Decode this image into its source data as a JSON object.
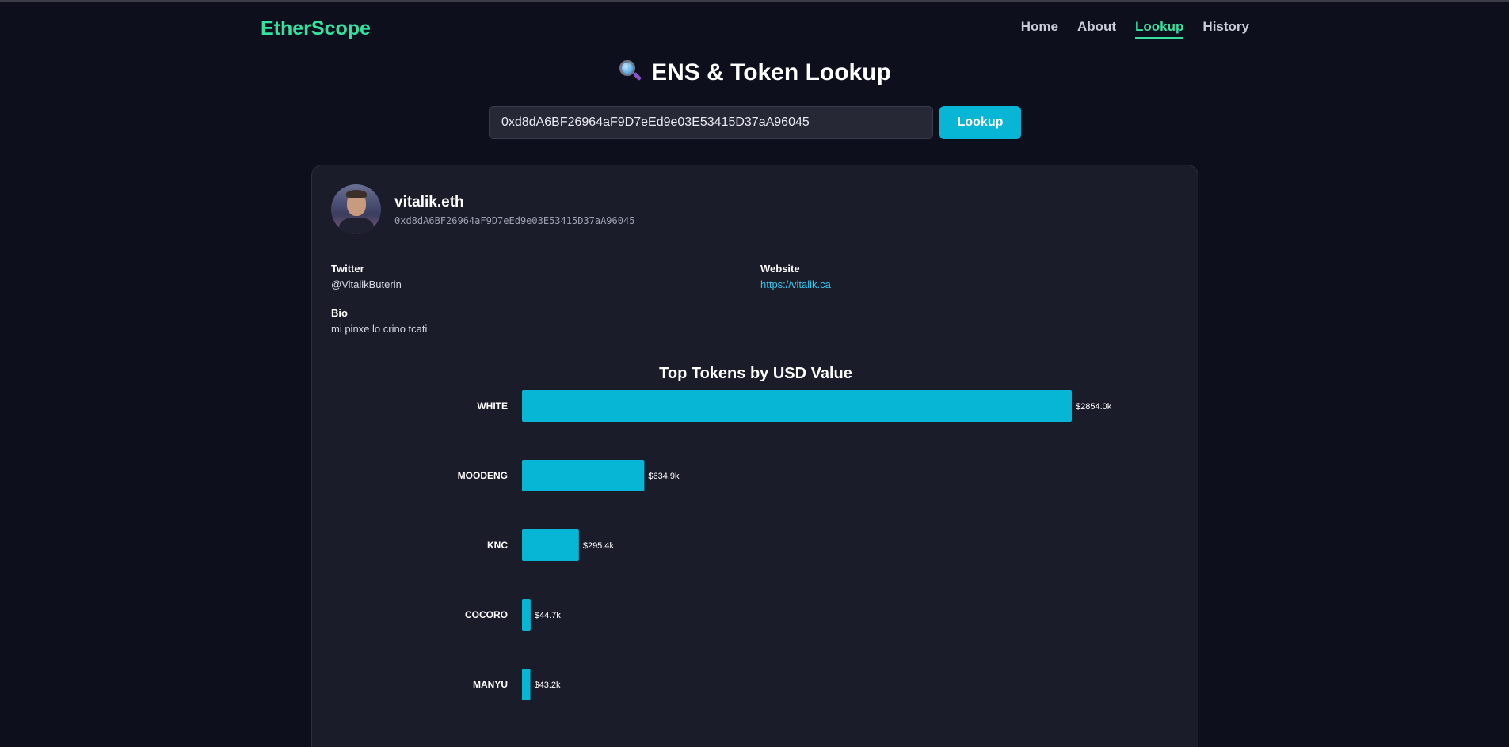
{
  "header": {
    "logo": "EtherScope",
    "nav": [
      {
        "label": "Home",
        "active": false
      },
      {
        "label": "About",
        "active": false
      },
      {
        "label": "Lookup",
        "active": true
      },
      {
        "label": "History",
        "active": false
      }
    ]
  },
  "page": {
    "title": "ENS & Token Lookup",
    "title_icon": "magnifying-glass-icon"
  },
  "search": {
    "value": "0xd8dA6BF26964aF9D7eEd9e03E53415D37aA96045",
    "button_label": "Lookup"
  },
  "profile": {
    "ens_name": "vitalik.eth",
    "address": "0xd8dA6BF26964aF9D7eEd9e03E53415D37aA96045",
    "twitter_label": "Twitter",
    "twitter_value": "@VitalikButerin",
    "website_label": "Website",
    "website_value": "https://vitalik.ca",
    "bio_label": "Bio",
    "bio_value": "mi pinxe lo crino tcati"
  },
  "colors": {
    "accent": "#34e2a0",
    "bar": "#06b6d4",
    "link": "#38c5ea"
  },
  "chart_data": {
    "type": "bar",
    "orientation": "horizontal",
    "title": "Top Tokens by USD Value",
    "categories": [
      "WHITE",
      "MOODENG",
      "KNC",
      "COCORO",
      "MANYU"
    ],
    "values": [
      2854.0,
      634.9,
      295.4,
      44.7,
      43.2
    ],
    "value_labels": [
      "$2854.0k",
      "$634.9k",
      "$295.4k",
      "$44.7k",
      "$43.2k"
    ],
    "unit": "USD (thousands)",
    "grid": false
  }
}
